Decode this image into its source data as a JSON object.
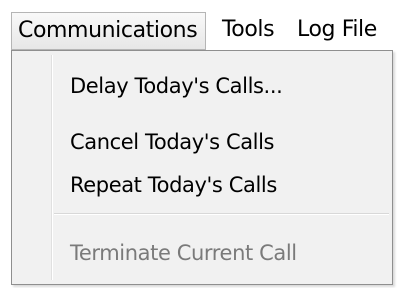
{
  "menubar": {
    "items": [
      {
        "label": "Communications",
        "state": "open"
      },
      {
        "label": "Tools"
      },
      {
        "label": "Log File"
      }
    ]
  },
  "communications_menu": {
    "items": [
      {
        "label": "Delay Today's Calls...",
        "enabled": true
      },
      {
        "label": "Cancel Today's Calls",
        "enabled": true
      },
      {
        "label": "Repeat Today's Calls",
        "enabled": true
      },
      {
        "label": "Terminate Current Call",
        "enabled": false
      }
    ]
  },
  "colors": {
    "menu_background": "#f1f1f1",
    "disabled_text": "#7a7a7a",
    "active_menu_border": "#b5b5b5"
  }
}
